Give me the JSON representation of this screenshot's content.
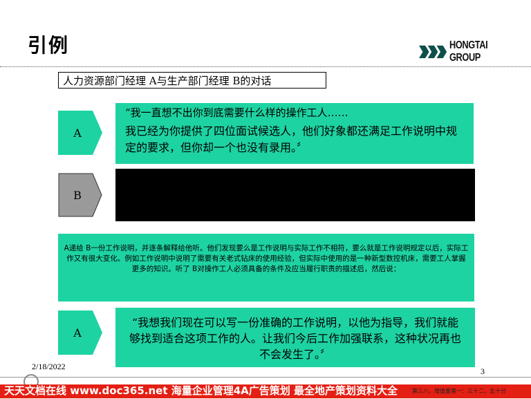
{
  "header": {
    "title": "引例",
    "logo_text": "HONGTAI GROUP"
  },
  "subject": "人力资源部门经理 A与生产部门经理 B的对话",
  "dialogue": {
    "speaker_a1": "A",
    "bubble_a1_line1": "“我一直想不出你到底需要什么样的操作工人……",
    "bubble_a1_line2": "我已经为你提供了四位面试候选人，他们好象都还满足工作说明中规定的要求，但你却一个也没有录用。〞",
    "speaker_b": "B",
    "story": "A递给 B一份工作说明，并逐条解释给他听。他们发现要么是工作说明与实际工作不相符，要么就是工作说明规定以后，实际工作又有很大变化。例如工作说明中说明了需要有关老式钻床的使用经验，但实际中使用的是一种新型数控机床，需要工人掌握更多的知识。听了 B对操作工人必须具备的条件及应当履行职责的描述后，然后说：",
    "speaker_a2": "A",
    "bubble_a2": "“我想我们现在可以写一份准确的工作说明，以他为指导，我们就能够找到适合这项工作的人。让我们今后工作加强联系，这种状况再也不会发生了。〞"
  },
  "footer": {
    "date": "2/18/2022",
    "page_number": "3"
  },
  "watermark": {
    "text": "天天文档在线 www.doc365.net 海量企业管理4A广告策划 最全地产策划资料大全",
    "small_text": "第三八，增值量第一：三十二，五十分"
  },
  "colors": {
    "bubble_green": "#1ed3a2",
    "arrow_green": "#1ed3a2",
    "arrow_gray": "#9a9a9a",
    "watermark_red": "#e41f13"
  }
}
